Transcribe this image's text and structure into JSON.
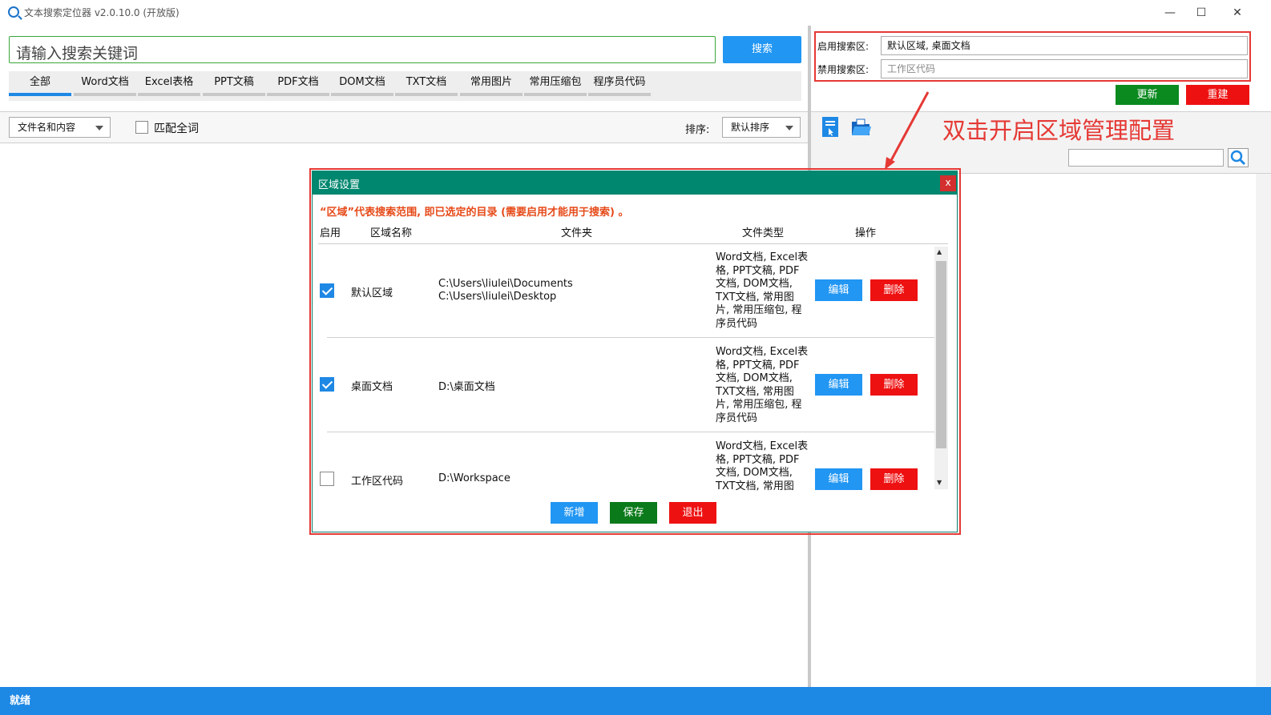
{
  "window": {
    "title": "文本搜索定位器 v2.0.10.0 (开放版)",
    "minimize": "—",
    "maximize": "☐",
    "close": "✕"
  },
  "search": {
    "placeholder": "请输入搜索关键词",
    "button": "搜索"
  },
  "tabs": [
    {
      "label": "全部",
      "active": true
    },
    {
      "label": "Word文档"
    },
    {
      "label": "Excel表格"
    },
    {
      "label": "PPT文稿"
    },
    {
      "label": "PDF文档"
    },
    {
      "label": "DOM文档"
    },
    {
      "label": "TXT文档"
    },
    {
      "label": "常用图片"
    },
    {
      "label": "常用压缩包"
    },
    {
      "label": "程序员代码"
    }
  ],
  "left_toolbar": {
    "scope_select": "文件名和内容",
    "match_whole": "匹配全词",
    "sort_label": "排序:",
    "sort_select": "默认排序"
  },
  "zones": {
    "enabled_label": "启用搜索区:",
    "enabled_value": "默认区域, 桌面文档",
    "disabled_label": "禁用搜索区:",
    "disabled_value": "工作区代码",
    "update_button": "更新",
    "rebuild_button": "重建",
    "update_color": "#0a8a1f",
    "rebuild_color": "#ee1111"
  },
  "annotation": "双击开启区域管理配置",
  "status": "就绪",
  "dialog": {
    "title": "区域设置",
    "close": "x",
    "note": "“区域”代表搜索范围, 即已选定的目录 (需要启用才能用于搜索) 。",
    "headers": {
      "enable": "启用",
      "name": "区域名称",
      "folder": "文件夹",
      "types": "文件类型",
      "ops": "操作"
    },
    "rows": [
      {
        "enabled": true,
        "name": "默认区域",
        "folders": [
          "C:\\Users\\liulei\\Documents",
          "C:\\Users\\liulei\\Desktop"
        ],
        "types": [
          "Word文档, Excel表",
          "格, PPT文稿, PDF",
          "文档, DOM文档,",
          "TXT文档, 常用图",
          "片, 常用压缩包, 程",
          "序员代码"
        ],
        "edit": "编辑",
        "delete": "删除"
      },
      {
        "enabled": true,
        "name": "桌面文档",
        "folders": [
          "D:\\桌面文档"
        ],
        "types": [
          "Word文档, Excel表",
          "格, PPT文稿, PDF",
          "文档, DOM文档,",
          "TXT文档, 常用图",
          "片, 常用压缩包, 程",
          "序员代码"
        ],
        "edit": "编辑",
        "delete": "删除"
      },
      {
        "enabled": false,
        "name": "工作区代码",
        "folders": [
          "D:\\Workspace"
        ],
        "types": [
          "Word文档, Excel表",
          "格, PPT文稿, PDF",
          "文档, DOM文档,",
          "TXT文档, 常用图"
        ],
        "edit": "编辑",
        "delete": "删除"
      }
    ],
    "add_button": "新增",
    "save_button": "保存",
    "exit_button": "退出"
  }
}
